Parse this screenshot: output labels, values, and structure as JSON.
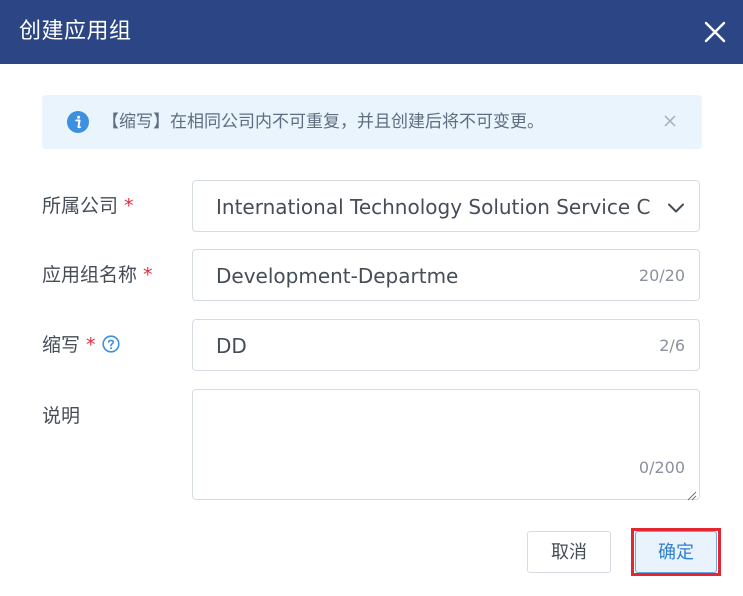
{
  "dialog": {
    "title": "创建应用组",
    "close_icon": "close-icon"
  },
  "alert": {
    "icon": "info-icon",
    "message": "【缩写】在相同公司内不可重复，并且创建后将不可变更。",
    "close_icon": "close-icon"
  },
  "form": {
    "company": {
      "label": "所属公司",
      "required_mark": "*",
      "value": "International Technology Solution Service C",
      "icon": "chevron-down-icon"
    },
    "group_name": {
      "label": "应用组名称",
      "required_mark": "*",
      "value": "Development-Departme",
      "counter": "20/20"
    },
    "abbreviation": {
      "label": "缩写",
      "required_mark": "*",
      "help_icon": "question-circle-icon",
      "value": "DD",
      "counter": "2/6"
    },
    "description": {
      "label": "说明",
      "value": "",
      "counter": "0/200"
    }
  },
  "footer": {
    "cancel_label": "取消",
    "confirm_label": "确定"
  },
  "colors": {
    "header_bg": "#2c4585",
    "alert_bg": "#eaf4fd",
    "info_icon": "#3d8fe0",
    "required": "#e8293b",
    "confirm_border": "#66a8e8",
    "highlight": "#e3262f"
  }
}
